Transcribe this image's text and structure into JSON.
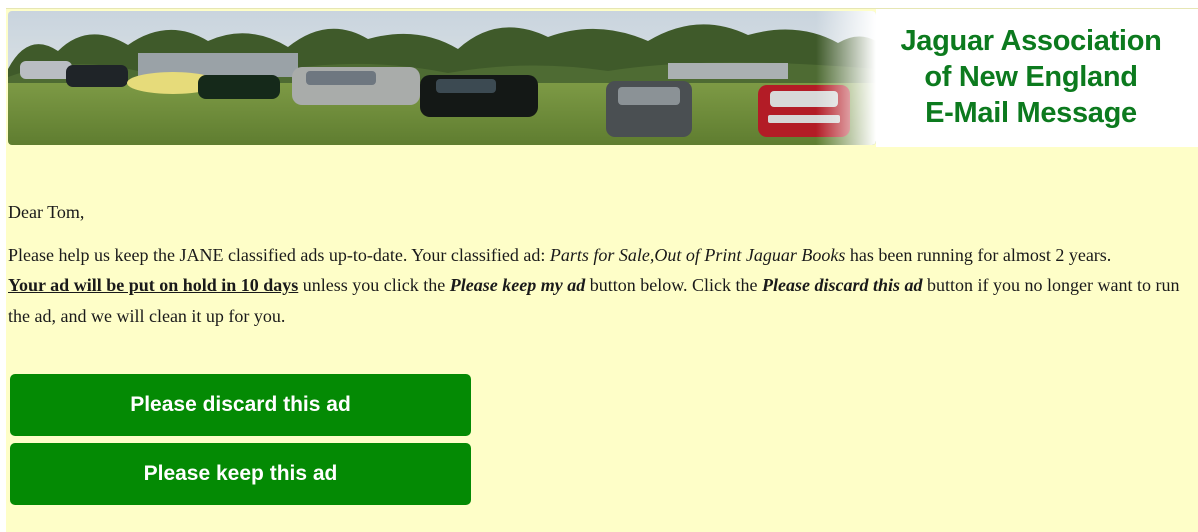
{
  "header": {
    "title_lines": [
      "Jaguar Association",
      "of New England",
      "E-Mail Message"
    ],
    "brand_color": "#0c7a1e"
  },
  "message": {
    "greeting": "Dear Tom,",
    "p1_before": "Please help us keep the JANE classified ads up-to-date. Your classified ad: ",
    "ad_title": "Parts for Sale,Out of Print Jaguar Books",
    "p1_after": " has been running for almost 2 years.",
    "hold_notice": "Your ad will be put on hold in 10 days",
    "p2_part1": " unless you click the ",
    "keep_ref": "Please keep my ad",
    "p2_part2": " button below. Click the ",
    "discard_ref": "Please discard this ad",
    "p2_part3": " button if you no longer want to run the ad, and we will clean it up for you."
  },
  "buttons": {
    "discard_label": "Please discard this ad",
    "keep_label": "Please keep this ad",
    "color": "#048a04"
  },
  "colors": {
    "page_background": "#fefec8"
  }
}
